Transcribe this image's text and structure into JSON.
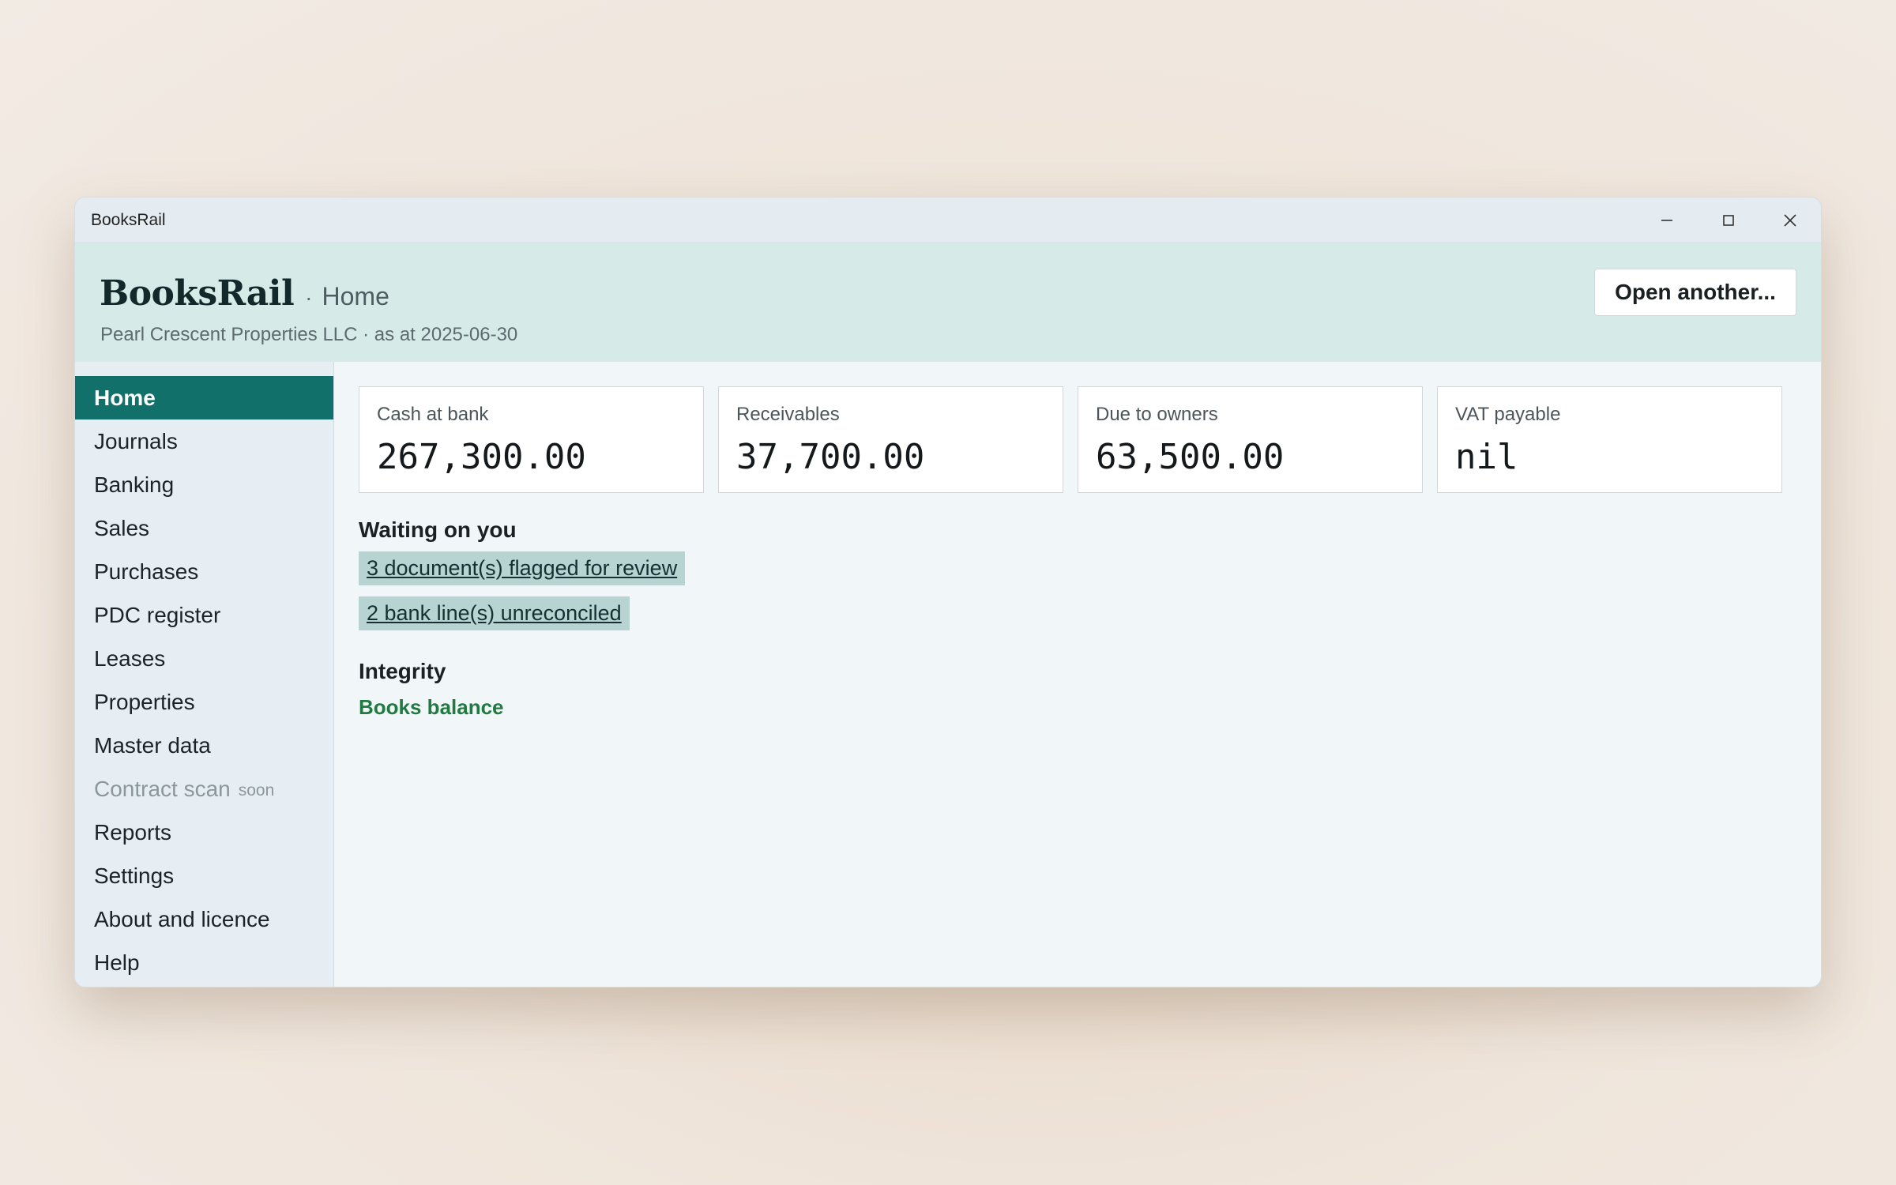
{
  "window": {
    "title": "BooksRail",
    "controls": {
      "minimize": "minimize-icon",
      "maximize": "maximize-icon",
      "close": "close-icon"
    }
  },
  "header": {
    "brand": "BooksRail",
    "separator": "·",
    "page": "Home",
    "subtitle": "Pearl Crescent Properties LLC · as at 2025-06-30",
    "open_button": "Open another..."
  },
  "sidebar": {
    "items": [
      {
        "label": "Home",
        "active": true
      },
      {
        "label": "Journals"
      },
      {
        "label": "Banking"
      },
      {
        "label": "Sales"
      },
      {
        "label": "Purchases"
      },
      {
        "label": "PDC register"
      },
      {
        "label": "Leases"
      },
      {
        "label": "Properties"
      },
      {
        "label": "Master data"
      },
      {
        "label": "Contract scan",
        "badge": "soon",
        "disabled": true
      },
      {
        "label": "Reports"
      },
      {
        "label": "Settings"
      },
      {
        "label": "About and licence"
      },
      {
        "label": "Help"
      }
    ]
  },
  "summary": {
    "cards": [
      {
        "label": "Cash at bank",
        "value": "267,300.00"
      },
      {
        "label": "Receivables",
        "value": "37,700.00"
      },
      {
        "label": "Due to owners",
        "value": "63,500.00"
      },
      {
        "label": "VAT payable",
        "value": "nil"
      }
    ]
  },
  "waiting": {
    "title": "Waiting on you",
    "tasks": [
      {
        "label": "3 document(s) flagged for review"
      },
      {
        "label": "2 bank line(s) unreconciled"
      }
    ]
  },
  "integrity": {
    "title": "Integrity",
    "status": "Books balance",
    "status_color": "#207a41"
  },
  "colors": {
    "accent": "#11706a",
    "header_bg": "#d6eae7",
    "task_bg": "#b7d4d2"
  }
}
